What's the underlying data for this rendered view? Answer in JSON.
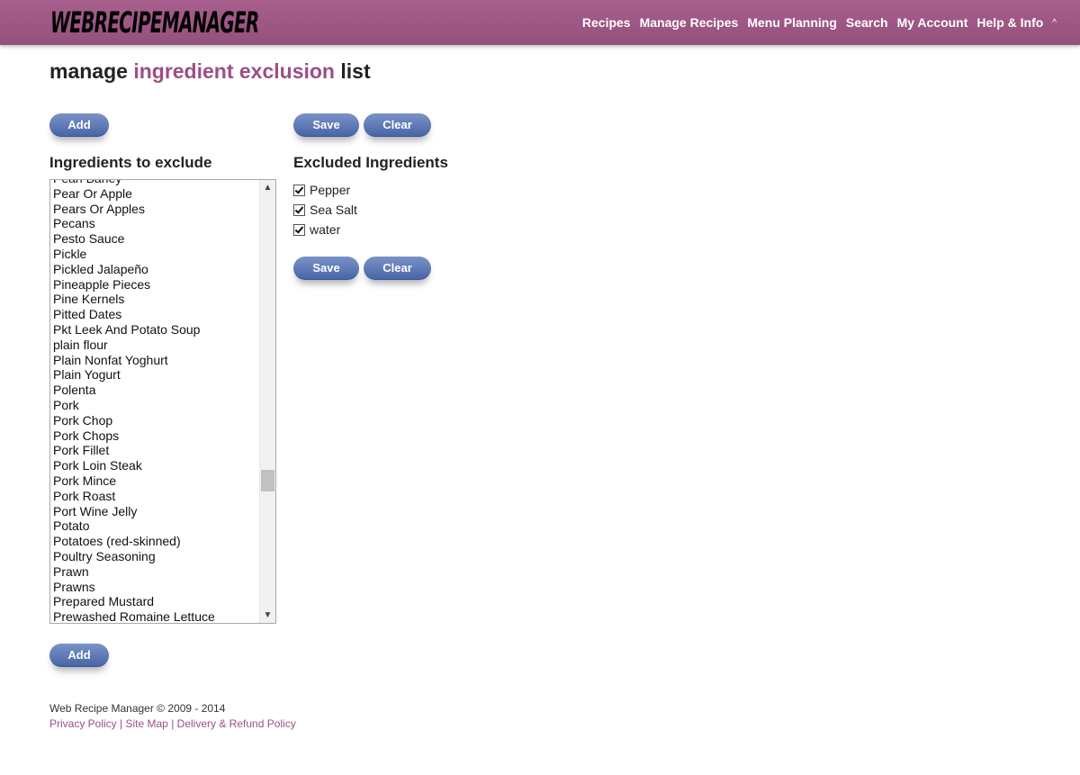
{
  "header": {
    "logo_text": "WEBRECIPEMANAGER",
    "nav": [
      "Recipes",
      "Manage Recipes",
      "Menu Planning",
      "Search",
      "My Account",
      "Help & Info"
    ],
    "caret": "^"
  },
  "page": {
    "title_part1": "manage",
    "title_highlight": "ingredient exclusion",
    "title_part2": "list"
  },
  "buttons": {
    "add": "Add",
    "save": "Save",
    "clear": "Clear"
  },
  "left": {
    "label": "Ingredients to exclude",
    "items": [
      "Pearl Barley",
      "Pear Or Apple",
      "Pears Or Apples",
      "Pecans",
      "Pesto Sauce",
      "Pickle",
      "Pickled Jalapeño",
      "Pineapple Pieces",
      "Pine Kernels",
      "Pitted Dates",
      "Pkt Leek And Potato Soup",
      "plain flour",
      "Plain Nonfat Yoghurt",
      "Plain Yogurt",
      "Polenta",
      "Pork",
      "Pork Chop",
      "Pork Chops",
      "Pork Fillet",
      "Pork Loin Steak",
      "Pork Mince",
      "Pork Roast",
      "Port Wine Jelly",
      "Potato",
      "Potatoes (red-skinned)",
      "Poultry Seasoning",
      "Prawn",
      "Prawns",
      "Prepared Mustard",
      "Prewashed Romaine Lettuce"
    ]
  },
  "right": {
    "label": "Excluded Ingredients",
    "items": [
      "Pepper",
      "Sea Salt",
      "water"
    ]
  },
  "footer": {
    "copyright": "Web Recipe Manager © 2009 - 2014",
    "links": [
      "Privacy Policy",
      "Site Map",
      "Delivery & Refund Policy"
    ],
    "separator": "|"
  }
}
